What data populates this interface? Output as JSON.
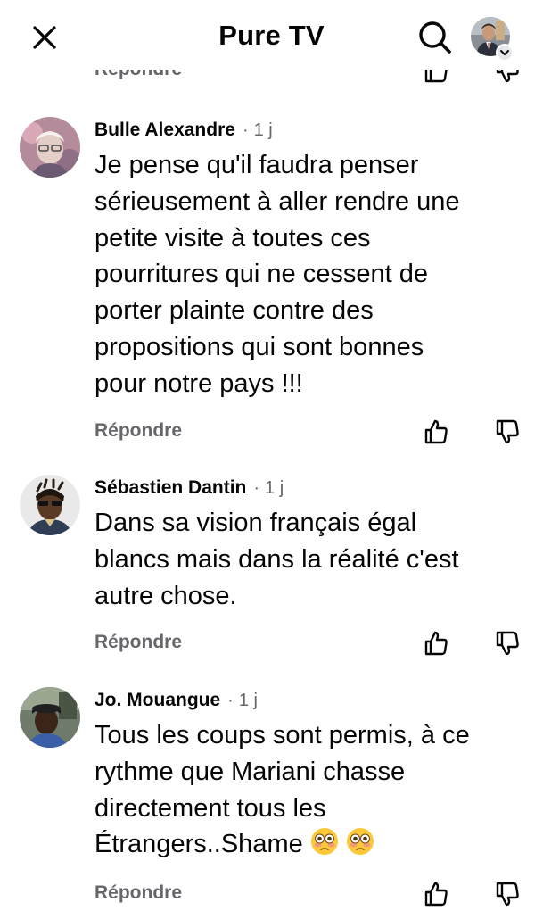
{
  "header": {
    "title": "Pure TV",
    "close_icon": "close-icon",
    "search_icon": "search-icon"
  },
  "partial_reply_label": "Répondre",
  "comments": [
    {
      "author": "Bulle Alexandre",
      "separator": "·",
      "time": "1 j",
      "lines": [
        "Je pense qu'il faudra penser",
        "sérieusement à aller rendre une",
        "petite visite à toutes ces",
        "pourritures qui ne cessent de",
        "porter plainte contre des",
        "propositions qui sont bonnes",
        "pour notre pays !!!"
      ],
      "reply_label": "Répondre"
    },
    {
      "author": "Sébastien Dantin",
      "separator": "·",
      "time": "1 j",
      "lines": [
        "Dans sa vision français égal",
        "blancs mais dans la réalité c'est",
        "autre chose."
      ],
      "reply_label": "Répondre"
    },
    {
      "author": "Jo. Mouangue",
      "separator": "·",
      "time": "1 j",
      "lines": [
        "Tous les coups sont permis, à ce",
        "rythme que Mariani chasse",
        "directement tous les",
        "Étrangers..Shame"
      ],
      "reply_label": "Répondre"
    }
  ],
  "colors": {
    "text": "#050505",
    "secondary": "#65676b",
    "background": "#ffffff"
  }
}
